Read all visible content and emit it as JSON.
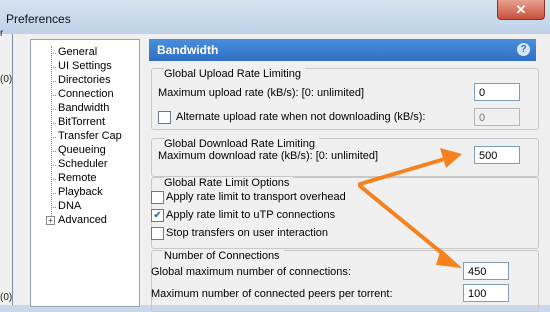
{
  "window": {
    "title": "Preferences",
    "close_glyph": "✕",
    "behind_fragments": [
      "r",
      "(0)",
      "(0)"
    ]
  },
  "sidebar": {
    "items": [
      {
        "label": "General"
      },
      {
        "label": "UI Settings"
      },
      {
        "label": "Directories"
      },
      {
        "label": "Connection"
      },
      {
        "label": "Bandwidth",
        "selected": true
      },
      {
        "label": "BitTorrent"
      },
      {
        "label": "Transfer Cap"
      },
      {
        "label": "Queueing"
      },
      {
        "label": "Scheduler"
      },
      {
        "label": "Remote"
      },
      {
        "label": "Playback"
      },
      {
        "label": "DNA"
      },
      {
        "label": "Advanced",
        "expander": "+"
      }
    ]
  },
  "panel": {
    "title": "Bandwidth",
    "help_glyph": "?"
  },
  "upload": {
    "group_title": "Global Upload Rate Limiting",
    "max_label": "Maximum upload rate (kB/s): [0: unlimited]",
    "max_value": "0",
    "alt_label": "Alternate upload rate when not downloading (kB/s):",
    "alt_checked": false,
    "alt_value": "0"
  },
  "download": {
    "group_title": "Global Download Rate Limiting",
    "max_label": "Maximum download rate (kB/s): [0: unlimited]",
    "max_value": "500"
  },
  "options": {
    "group_title": "Global Rate Limit Options",
    "items": [
      {
        "label": "Apply rate limit to transport overhead",
        "checked": false
      },
      {
        "label": "Apply rate limit to uTP connections",
        "checked": true
      },
      {
        "label": "Stop transfers on user interaction",
        "checked": false
      }
    ]
  },
  "connections": {
    "group_title": "Number of Connections",
    "global_label": "Global maximum number of connections:",
    "global_value": "450",
    "peers_label": "Maximum number of connected peers per torrent:",
    "peers_value": "100"
  },
  "annotation": {
    "arrow_color": "#f5821f"
  }
}
